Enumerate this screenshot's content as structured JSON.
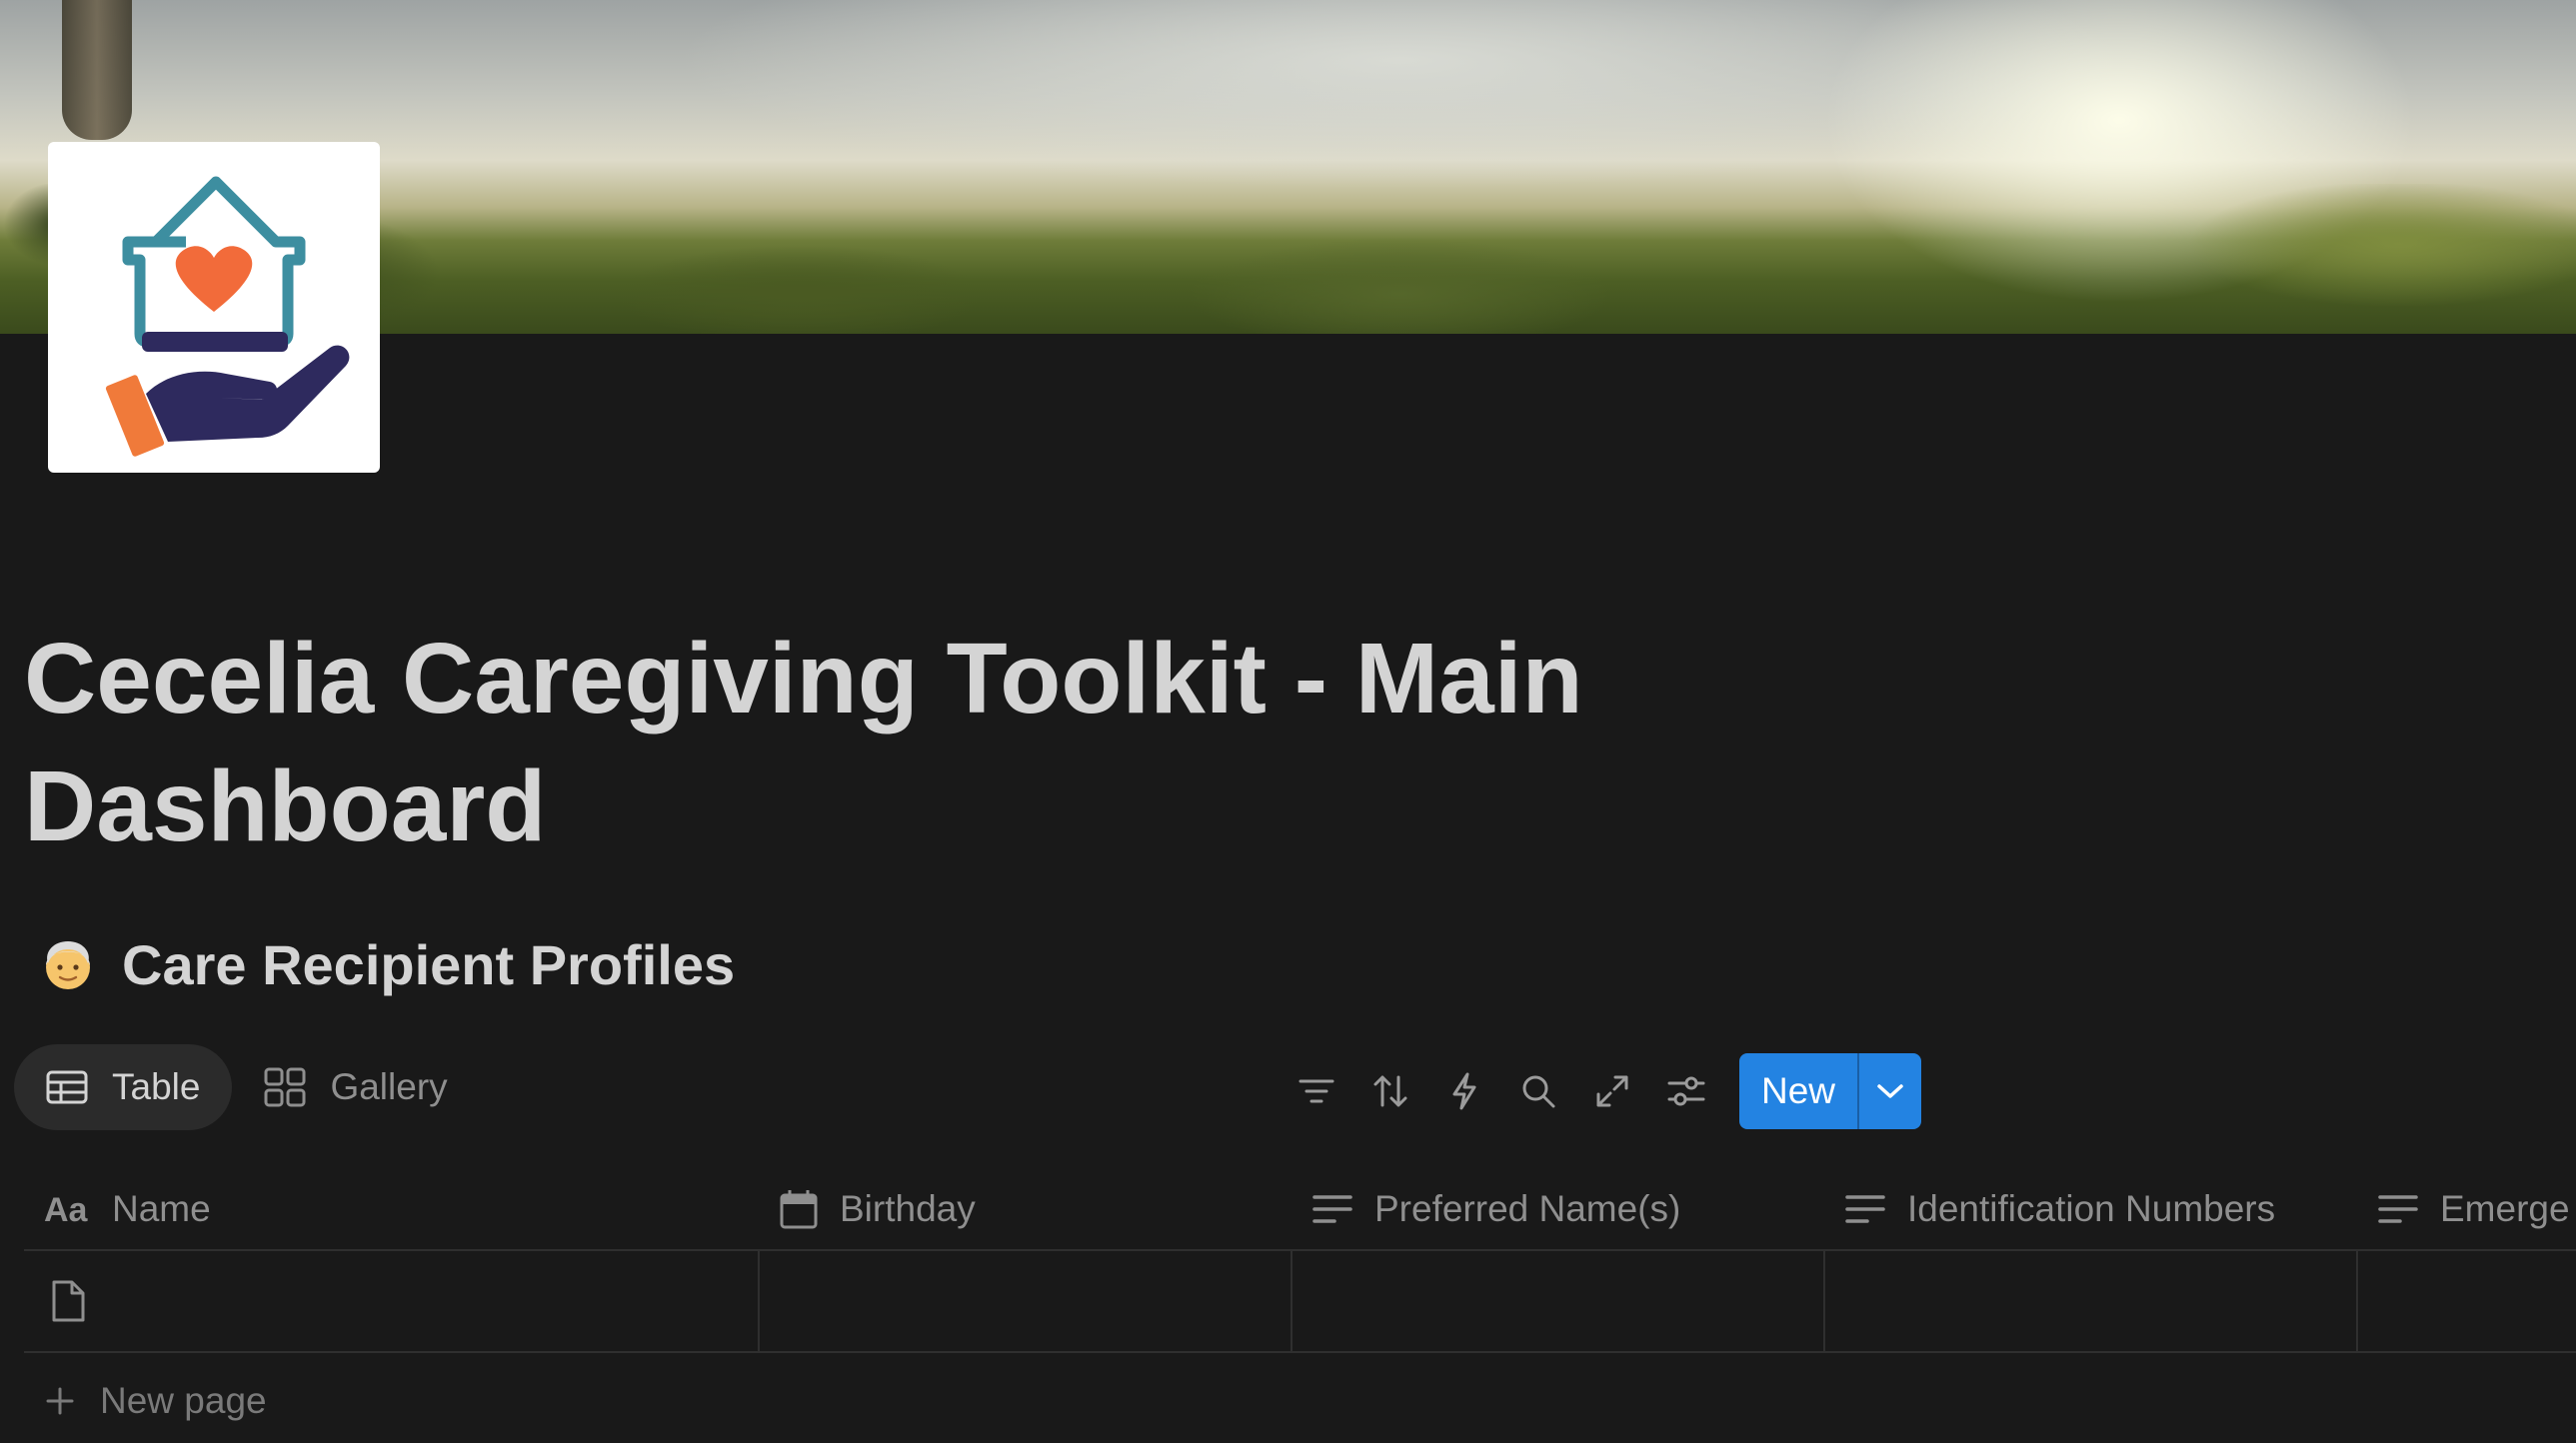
{
  "page": {
    "title": "Cecelia Caregiving Toolkit - Main Dashboard",
    "cover_description": "sunlit-forest-cover",
    "icon": "house-heart-hand-logo"
  },
  "section": {
    "emoji": "older-person-emoji",
    "heading": "Care Recipient Profiles"
  },
  "views": [
    {
      "label": "Table",
      "icon": "table-icon",
      "active": true
    },
    {
      "label": "Gallery",
      "icon": "gallery-icon",
      "active": false
    }
  ],
  "toolbar": {
    "icons": [
      "filter-icon",
      "sort-icon",
      "automation-icon",
      "search-icon",
      "expand-icon",
      "settings-icon"
    ],
    "new_label": "New"
  },
  "table": {
    "columns": [
      {
        "label": "Name",
        "icon": "title-aa-icon"
      },
      {
        "label": "Birthday",
        "icon": "calendar-icon"
      },
      {
        "label": "Preferred Name(s)",
        "icon": "text-lines-icon"
      },
      {
        "label": "Identification Numbers",
        "icon": "text-lines-icon"
      },
      {
        "label": "Emerge",
        "icon": "text-lines-icon"
      }
    ],
    "rows": [
      {
        "name": "",
        "birthday": "",
        "preferred_names": "",
        "identification_numbers": "",
        "emergency": ""
      }
    ],
    "new_page_label": "New page"
  },
  "colors": {
    "background": "#191919",
    "text": "#d4d4d4",
    "muted": "#8f8f8f",
    "accent": "#2383e2",
    "logo_teal": "#3d8ea0",
    "logo_orange": "#f26b3a",
    "logo_navy": "#2e2a5e"
  }
}
